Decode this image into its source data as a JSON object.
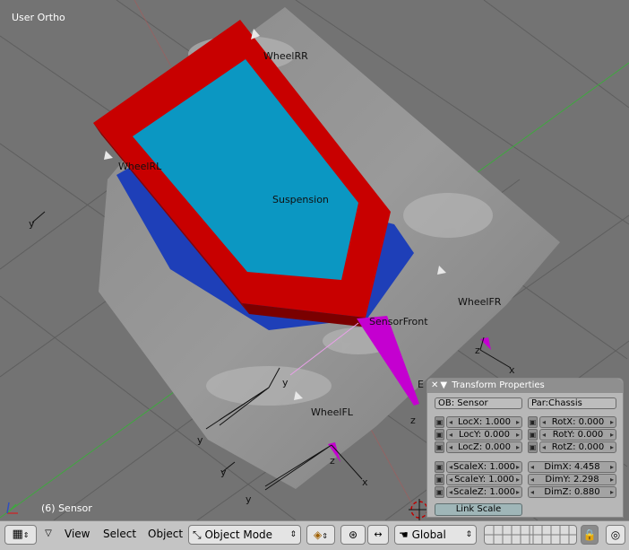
{
  "viewport": {
    "view_name": "User Ortho",
    "active_object_info": "(6) Sensor",
    "objects": {
      "suspension": "Suspension",
      "wheel_rr": "WheelRR",
      "wheel_rl": "WheelRL",
      "wheel_fr": "WheelFR",
      "wheel_fl": "WheelFL",
      "sensor_label": "SensorFront",
      "e_label": "E"
    },
    "axis_labels": {
      "y": "y",
      "z": "z",
      "x": "x"
    }
  },
  "transform_panel": {
    "title": "Transform Properties",
    "ob_name": "OB: Sensor",
    "parent": "Par:Chassis",
    "loc": [
      "LocX: 1.000",
      "LocY: 0.000",
      "LocZ: 0.000"
    ],
    "rot": [
      "RotX: 0.000",
      "RotY: 0.000",
      "RotZ: 0.000"
    ],
    "scale": [
      "ScaleX: 1.000",
      "ScaleY: 1.000",
      "ScaleZ: 1.000"
    ],
    "dim": [
      "DimX: 4.458",
      "DimY: 2.298",
      "DimZ: 0.880"
    ],
    "link_scale": "Link Scale"
  },
  "header": {
    "menus": [
      "View",
      "Select",
      "Object"
    ],
    "mode": "Object Mode",
    "orientation": "Global"
  },
  "colors": {
    "frame_red": "#c80000",
    "face_cyan": "#0b97c2",
    "body_blue": "#1e3fb8",
    "sensor_magenta": "#c400d0",
    "grid_green": "#3fa83f"
  }
}
